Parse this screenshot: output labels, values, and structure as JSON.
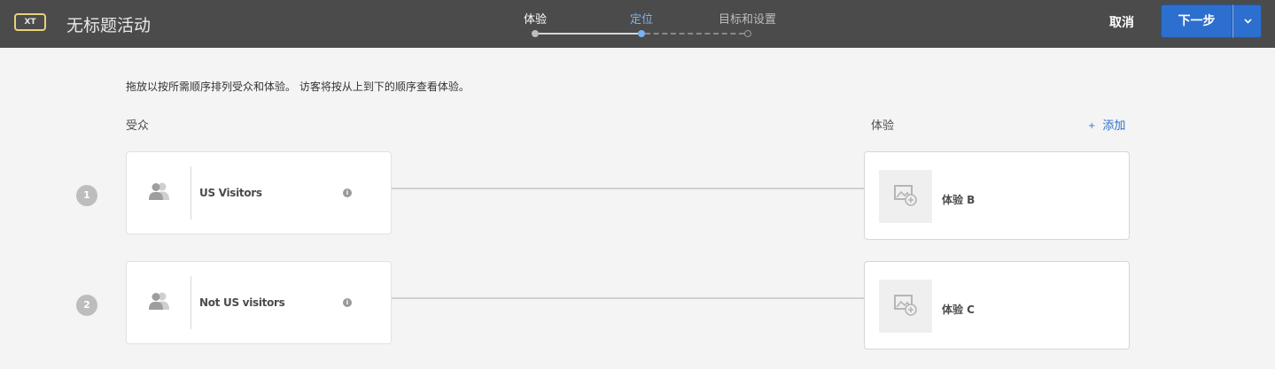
{
  "header": {
    "badge": "XT",
    "title": "无标题活动",
    "steps": [
      {
        "label": "体验",
        "state": "done"
      },
      {
        "label": "定位",
        "state": "current"
      },
      {
        "label": "目标和设置",
        "state": "upcoming"
      }
    ],
    "cancel_label": "取消",
    "next_label": "下一步"
  },
  "colors": {
    "accent": "#2d6fcf",
    "current_step": "#7ab3f0",
    "header_bg": "#4b4b4b"
  },
  "main": {
    "instructions": "拖放以按所需顺序排列受众和体验。 访客将按从上到下的顺序查看体验。",
    "audience_label": "受众",
    "experience_label": "体验",
    "add_label": "添加",
    "rows": [
      {
        "number": "1",
        "audience": "US Visitors",
        "experience": "体验 B"
      },
      {
        "number": "2",
        "audience": "Not US visitors",
        "experience": "体验 C"
      }
    ]
  },
  "icons": {
    "audience": "people-icon",
    "info": "info-icon",
    "experience": "image-add-icon",
    "dropdown": "chevron-down-icon"
  }
}
